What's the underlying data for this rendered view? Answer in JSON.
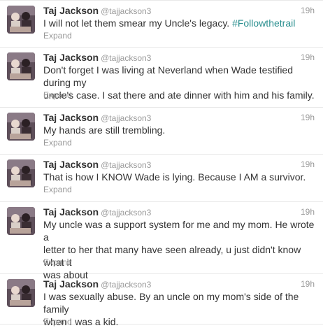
{
  "tweets": [
    {
      "name": "Taj Jackson",
      "handle": "@tajjackson3",
      "time": "19h",
      "text": "I will not let them smear my Uncle's legacy. ",
      "hashtag": "#Followthetrail",
      "expand": "Expand"
    },
    {
      "name": "Taj Jackson",
      "handle": "@tajjackson3",
      "time": "19h",
      "line1": "Don't forget I was living at Neverland when Wade testified during my",
      "line2": "uncle's case. I sat there and ate dinner with him and his family.",
      "expand": "Expand"
    },
    {
      "name": "Taj Jackson",
      "handle": "@tajjackson3",
      "time": "19h",
      "text": "My hands are still trembling.",
      "expand": "Expand"
    },
    {
      "name": "Taj Jackson",
      "handle": "@tajjackson3",
      "time": "19h",
      "text": "That is how I KNOW Wade is lying. Because I AM a survivor.",
      "expand": "Expand"
    },
    {
      "name": "Taj Jackson",
      "handle": "@tajjackson3",
      "time": "19h",
      "line1": "My uncle was a support system for me and my mom. He wrote a",
      "line2": "letter to her that many have seen already, u just didn't know what it",
      "line3": "was about",
      "expand": "Expand"
    },
    {
      "name": "Taj Jackson",
      "handle": "@tajjackson3",
      "time": "19h",
      "line1": "I was sexually abuse. By an uncle on my mom's side of the family",
      "line2": "when I was a kid.",
      "expand": "Expand"
    }
  ],
  "colors": {
    "hashtag": "#2a8f8f",
    "muted": "#999999",
    "text": "#333333"
  },
  "icons": {
    "avatar": "profile-photo-icon"
  }
}
